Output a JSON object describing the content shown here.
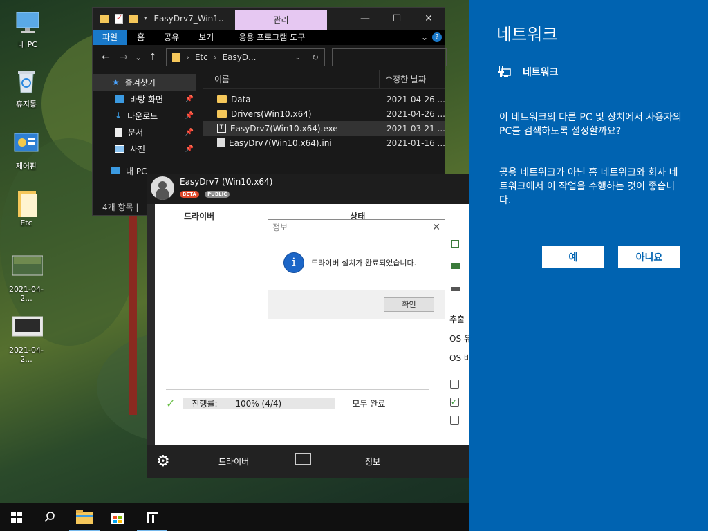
{
  "desktop": {
    "icons": [
      {
        "label": "내 PC",
        "icon": "monitor-icon"
      },
      {
        "label": "휴지통",
        "icon": "recycle-bin-icon"
      },
      {
        "label": "제어판",
        "icon": "control-panel-icon"
      },
      {
        "label": "Etc",
        "icon": "folder-icon"
      },
      {
        "label": "2021-04-2...",
        "icon": "image-thumbnail-icon"
      },
      {
        "label": "2021-04-2...",
        "icon": "image-thumbnail-icon"
      }
    ]
  },
  "explorer": {
    "title": "EasyDrv7_Win1...",
    "manage_tab": "관리",
    "controls": {
      "minimize": "—",
      "maximize": "☐",
      "close": "✕"
    },
    "ribbon": [
      "파일",
      "홈",
      "공유",
      "보기",
      "응용 프로그램 도구"
    ],
    "nav": {
      "back": "←",
      "forward": "→",
      "recent": "⌄",
      "up": "↑",
      "refresh": "↻"
    },
    "breadcrumb": [
      "Etc",
      "EasyD..."
    ],
    "sidebar": [
      {
        "label": "즐겨찾기",
        "icon": "star-icon",
        "pinned": false
      },
      {
        "label": "바탕 화면",
        "icon": "desktop-icon",
        "pinned": true
      },
      {
        "label": "다운로드",
        "icon": "download-icon",
        "pinned": true
      },
      {
        "label": "문서",
        "icon": "document-icon",
        "pinned": true
      },
      {
        "label": "사진",
        "icon": "pictures-icon",
        "pinned": true
      },
      {
        "label": "내 PC",
        "icon": "monitor-icon",
        "pinned": false
      }
    ],
    "columns": {
      "name": "이름",
      "date": "수정한 날짜"
    },
    "files": [
      {
        "name": "Data",
        "date": "2021-04-26 ...",
        "icon": "folder-icon",
        "selected": false
      },
      {
        "name": "Drivers(Win10.x64)",
        "date": "2021-04-26 ...",
        "icon": "folder-icon",
        "selected": false
      },
      {
        "name": "EasyDrv7(Win10.x64).exe",
        "date": "2021-03-21 ...",
        "icon": "exe-icon",
        "selected": true
      },
      {
        "name": "EasyDrv7(Win10.x64).ini",
        "date": "2021-01-16 ...",
        "icon": "ini-file-icon",
        "selected": false
      }
    ],
    "status": "4개 항목 |"
  },
  "easydrv": {
    "title": "EasyDrv7 (Win10.x64)",
    "badges": [
      {
        "label": "BETA",
        "color": "#e0492b"
      },
      {
        "label": "PUBLIC",
        "color": "#888888"
      }
    ],
    "columns": {
      "driver": "드라이버",
      "status": "상태"
    },
    "progress": {
      "label": "진행률:",
      "value": "100% (4/4)",
      "status": "모두 완료",
      "fraction": 1.0
    },
    "right_strip": {
      "extract": "추출",
      "os1": "OS 유",
      "os2": "OS 버"
    },
    "footer": {
      "driver": "드라이버",
      "info": "정보"
    }
  },
  "dialog": {
    "title": "정보",
    "message": "드라이버 설치가 완료되었습니다.",
    "ok": "확인",
    "info_glyph": "i"
  },
  "network": {
    "title": "네트워크",
    "subtitle": "네트워크",
    "paragraph1": "이 네트워크의 다른 PC 및 장치에서 사용자의 PC를 검색하도록 설정할까요?",
    "paragraph2": "공용 네트워크가 아닌 홈 네트워크와 회사 네트워크에서 이 작업을 수행하는 것이 좋습니다.",
    "yes": "예",
    "no": "아니요",
    "accent": "#0063b1"
  },
  "taskbar": {
    "items": [
      "start-icon",
      "search-icon",
      "file-explorer-icon",
      "store-icon",
      "easydrv-icon"
    ]
  }
}
